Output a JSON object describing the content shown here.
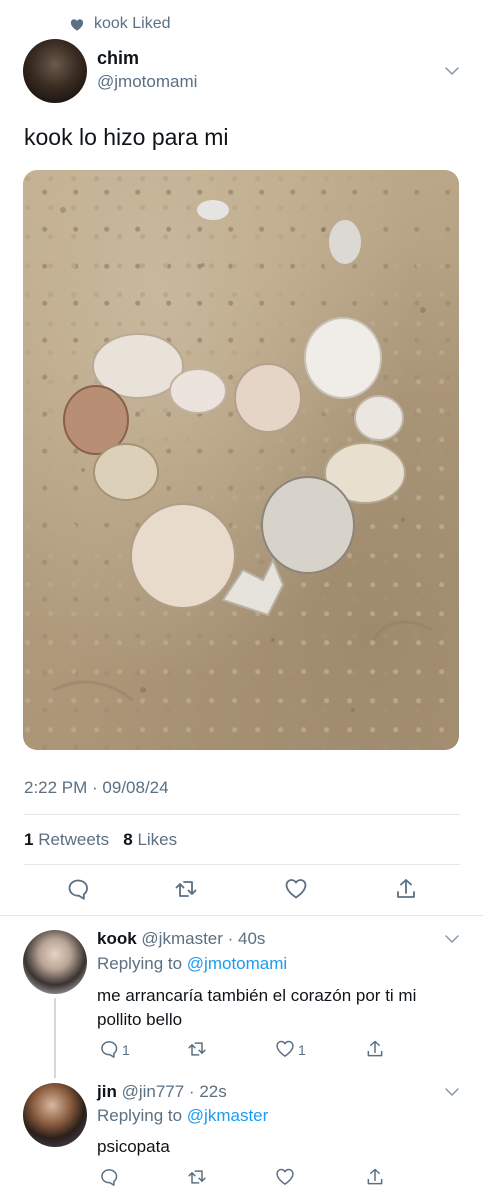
{
  "context": {
    "text": "kook Liked",
    "icon": "heart-icon"
  },
  "tweet": {
    "name": "chim",
    "handle": "@jmotomami",
    "text": "kook lo hizo para mi",
    "timestamp": "2:22 PM · 09/08/24",
    "retweets": "1",
    "retweets_label": "Retweets",
    "likes": "8",
    "likes_label": "Likes"
  },
  "replies": [
    {
      "name": "kook",
      "handle_time": "@jkmaster · 40s",
      "replying_prefix": "Replying to",
      "replying_to": "@jmotomami",
      "text": "me arrancaría también el corazón por ti mi pollito bello",
      "reply_count": "1",
      "like_count": "1"
    },
    {
      "name": "jin",
      "handle_time": "@jin777 · 22s",
      "replying_prefix": "Replying to",
      "replying_to": "@jkmaster",
      "text": "psicopata"
    }
  ],
  "colors": {
    "accent": "#1d9bf0",
    "secondary_text": "#5b7083",
    "divider": "#e1e8ed"
  }
}
